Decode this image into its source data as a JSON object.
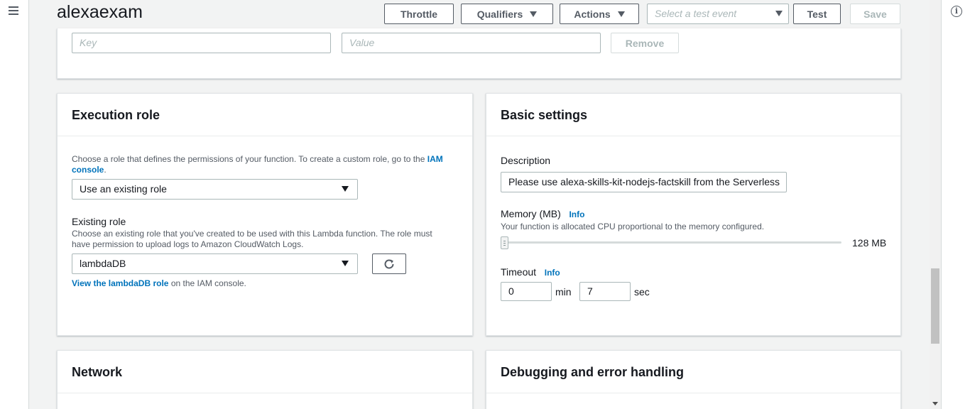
{
  "header": {
    "title": "alexaexam",
    "throttle_label": "Throttle",
    "qualifiers_label": "Qualifiers",
    "actions_label": "Actions",
    "test_event_placeholder": "Select a test event",
    "test_label": "Test",
    "save_label": "Save"
  },
  "env_vars": {
    "key_placeholder": "Key",
    "value_placeholder": "Value",
    "remove_label": "Remove"
  },
  "execution_role": {
    "title": "Execution role",
    "description_prefix": "Choose a role that defines the permissions of your function. To create a custom role, go to the ",
    "iam_link_part1": "IAM",
    "iam_link_part2": "console",
    "description_suffix": ".",
    "role_select_value": "Use an existing role",
    "existing_role_label": "Existing role",
    "existing_role_help_line1": "Choose an existing role that you've created to be used with this Lambda function. The role must",
    "existing_role_help_line2": "have permission to upload logs to Amazon CloudWatch Logs.",
    "existing_role_value": "lambdaDB",
    "view_role_link": "View the lambdaDB role",
    "view_role_suffix": " on the IAM console."
  },
  "basic_settings": {
    "title": "Basic settings",
    "description_label": "Description",
    "description_value": "Please use alexa-skills-kit-nodejs-factskill from the Serverless",
    "memory_label": "Memory (MB)",
    "memory_info": "Info",
    "memory_help": "Your function is allocated CPU proportional to the memory configured.",
    "memory_value": "128 MB",
    "memory_slider_fraction": 0,
    "timeout_label": "Timeout",
    "timeout_info": "Info",
    "timeout_min_value": "0",
    "timeout_min_unit": "min",
    "timeout_sec_value": "7",
    "timeout_sec_unit": "sec"
  },
  "network": {
    "title": "Network"
  },
  "debugging": {
    "title": "Debugging and error handling"
  },
  "colors": {
    "link": "#0073bb",
    "background": "#f2f3f3",
    "border": "#aab7b8"
  }
}
